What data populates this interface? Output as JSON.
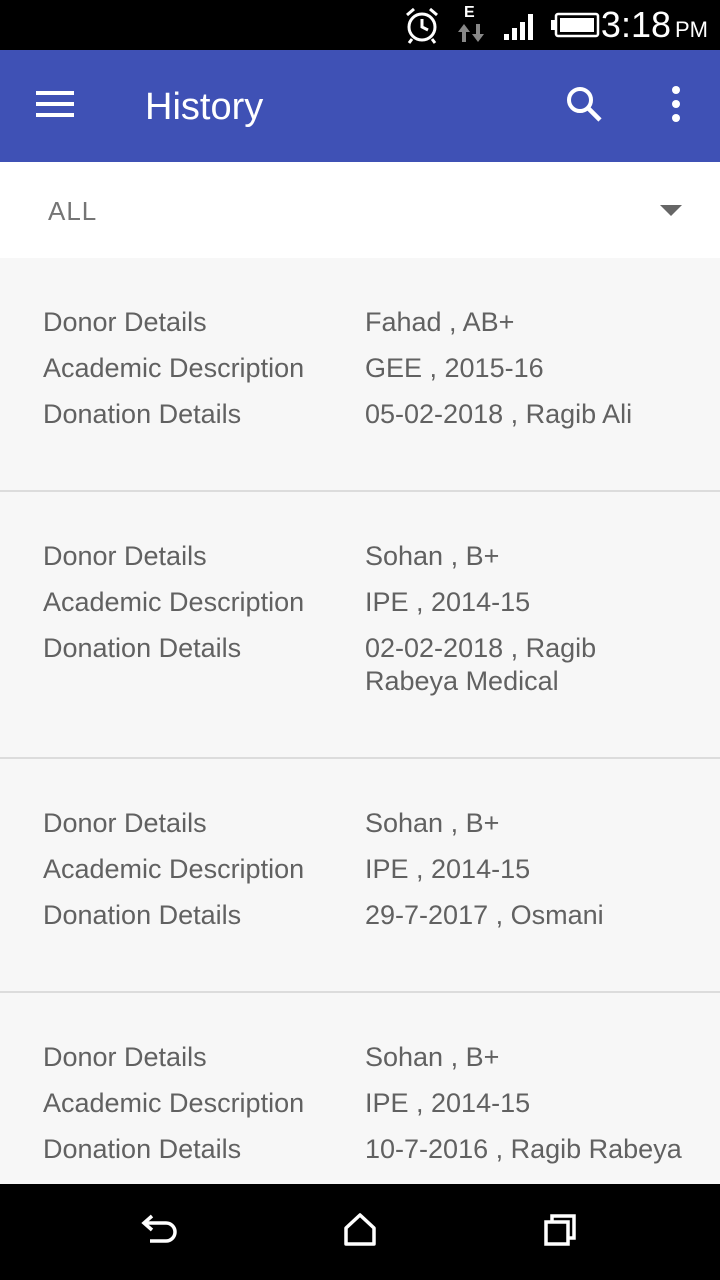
{
  "status_bar": {
    "time": "3:18",
    "ampm": "PM",
    "network_type": "E"
  },
  "app_bar": {
    "title": "History",
    "menu_icon": "hamburger-menu-icon",
    "search_icon": "search-icon",
    "more_icon": "more-vertical-icon"
  },
  "filter": {
    "selected": "ALL"
  },
  "history": [
    {
      "donor_label": "Donor Details",
      "donor_value": "Fahad , AB+",
      "academic_label": "Academic Description",
      "academic_value": "GEE , 2015-16",
      "donation_label": "Donation Details",
      "donation_value": "05-02-2018 , Ragib Ali"
    },
    {
      "donor_label": "Donor Details",
      "donor_value": "Sohan , B+",
      "academic_label": "Academic Description",
      "academic_value": "IPE , 2014-15",
      "donation_label": "Donation Details",
      "donation_value": "02-02-2018 , Ragib Rabeya Medical"
    },
    {
      "donor_label": "Donor Details",
      "donor_value": "Sohan , B+",
      "academic_label": "Academic Description",
      "academic_value": "IPE , 2014-15",
      "donation_label": "Donation Details",
      "donation_value": "29-7-2017 , Osmani"
    },
    {
      "donor_label": "Donor Details",
      "donor_value": "Sohan , B+",
      "academic_label": "Academic Description",
      "academic_value": "IPE , 2014-15",
      "donation_label": "Donation Details",
      "donation_value": "10-7-2016 , Ragib Rabeya"
    }
  ],
  "colors": {
    "primary": "#3f51b5",
    "status_bar": "#000000",
    "text_secondary": "#616161"
  }
}
